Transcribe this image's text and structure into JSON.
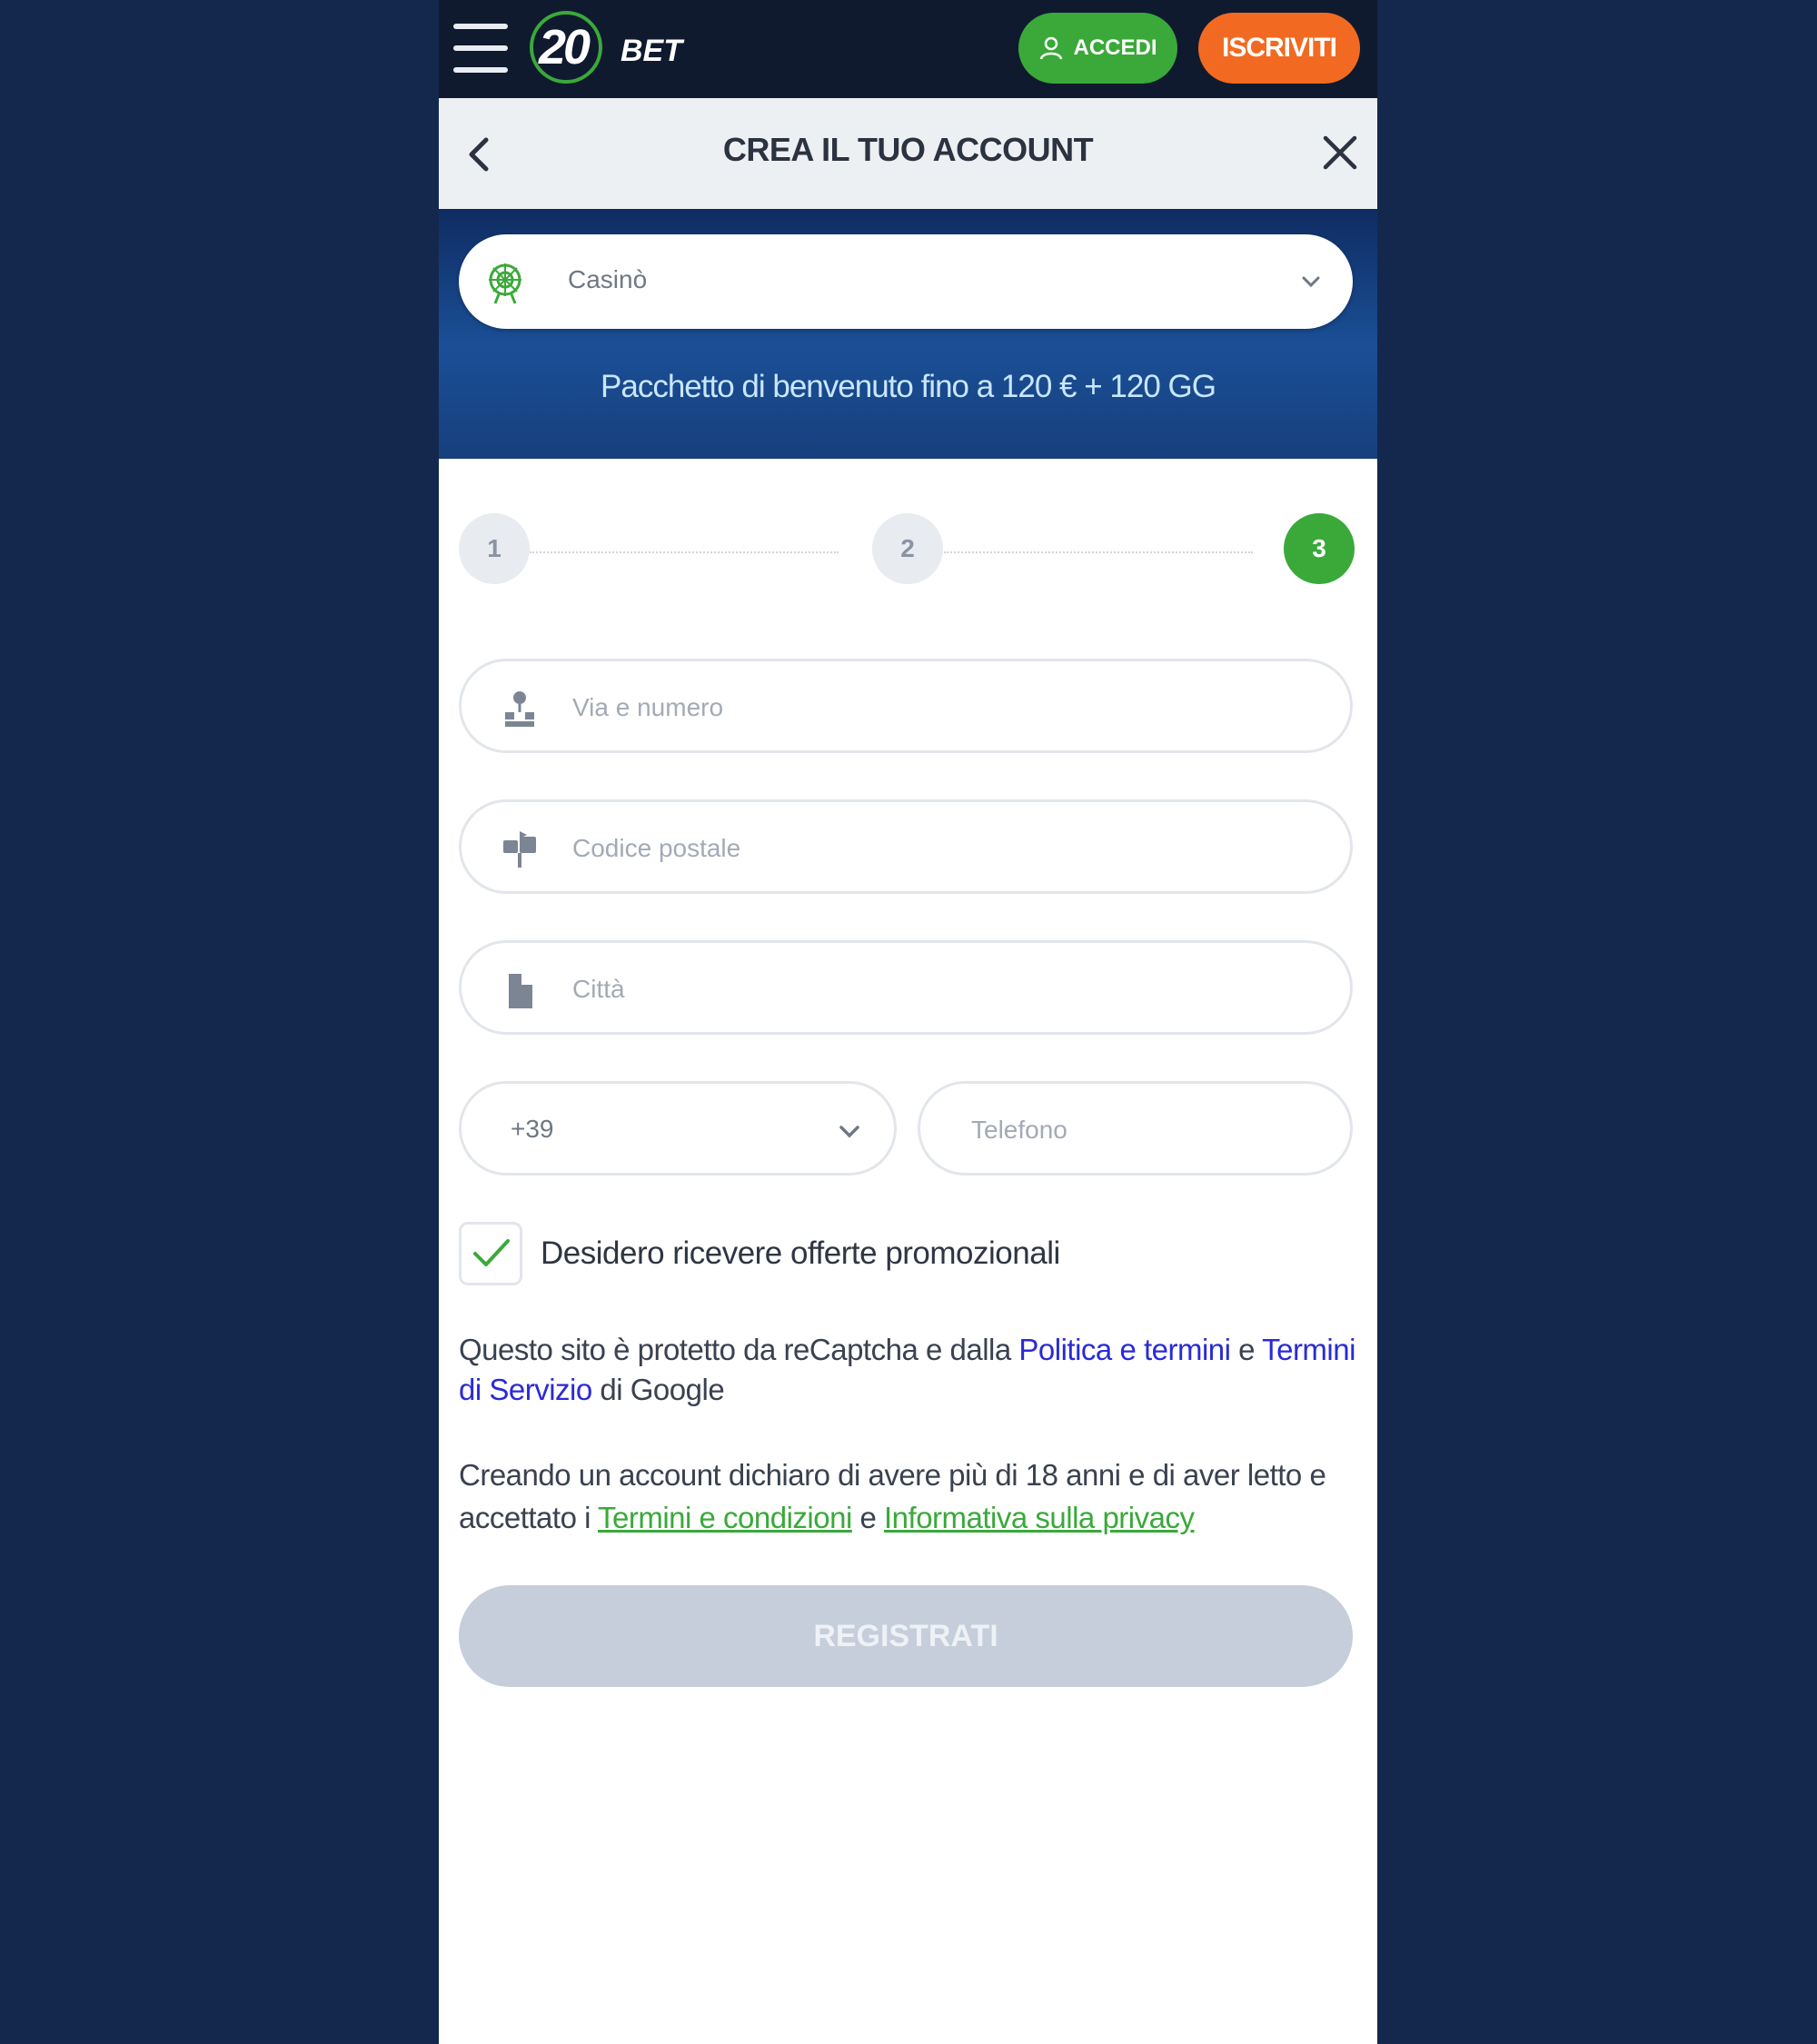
{
  "topbar": {
    "logo_number": "20",
    "logo_text": "BET",
    "login_label": "ACCEDI",
    "signup_label": "ISCRIVITI",
    "colors": {
      "login": "#3aa93a",
      "signup": "#f26a21"
    }
  },
  "header": {
    "title": "CREA IL TUO ACCOUNT"
  },
  "bonus": {
    "selected": "Casinò",
    "promo": "Pacchetto di benvenuto fino a 120 € + 120 GG"
  },
  "steps": {
    "items": [
      "1",
      "2",
      "3"
    ],
    "active": "3"
  },
  "form": {
    "street_placeholder": "Via e numero",
    "postal_placeholder": "Codice postale",
    "city_placeholder": "Città",
    "phone_code": "+39",
    "phone_placeholder": "Telefono",
    "promo_checkbox_label": "Desidero ricevere offerte promozionali",
    "promo_checked": true
  },
  "legal": {
    "recaptcha_prefix": "Questo sito è protetto da reCaptcha e dalla ",
    "recaptcha_link1": "Politica e termini",
    "recaptcha_mid": " e ",
    "recaptcha_link2": "Termini di Servizio",
    "recaptcha_suffix": " di Google",
    "age_prefix": "Creando un account dichiaro di avere più di 18 anni e di aver letto e accettato i ",
    "age_link1": "Termini e condizioni",
    "age_mid": " e ",
    "age_link2": "Informativa sulla privacy"
  },
  "submit_label": "REGISTRATI"
}
